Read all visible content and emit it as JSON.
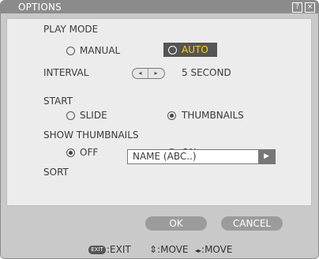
{
  "window": {
    "title": "OPTIONS",
    "help_label": "?",
    "close_label": "×"
  },
  "play_mode": {
    "label": "PLAY MODE",
    "options": [
      {
        "label": "MANUAL",
        "selected": false
      },
      {
        "label": "AUTO",
        "selected": true
      }
    ]
  },
  "interval": {
    "label": "INTERVAL",
    "left_arrow": "◂",
    "right_arrow": "▸",
    "value": "5 SECOND"
  },
  "start": {
    "label": "START",
    "options": [
      {
        "label": "SLIDE",
        "selected": false
      },
      {
        "label": "THUMBNAILS",
        "selected": true
      }
    ]
  },
  "show_thumbnails": {
    "label": "SHOW THUMBNAILS",
    "options": [
      {
        "label": "OFF",
        "selected": true
      },
      {
        "label": "ON",
        "selected": false
      }
    ]
  },
  "sort": {
    "label": "SORT",
    "value": "NAME (ABC..)",
    "arrow": "▶"
  },
  "buttons": {
    "ok": "OK",
    "cancel": "CANCEL"
  },
  "statusbar": {
    "exit_icon": "EXIT",
    "exit": ":EXIT",
    "move_vertical_icon": "⇕",
    "move_vertical": ":MOVE",
    "move_horizontal_icon": "◂▸",
    "move_horizontal": ":MOVE"
  },
  "colors": {
    "title_bar": "#8b8b8b",
    "highlight": "#555555",
    "auto_text": "#ffd400"
  }
}
